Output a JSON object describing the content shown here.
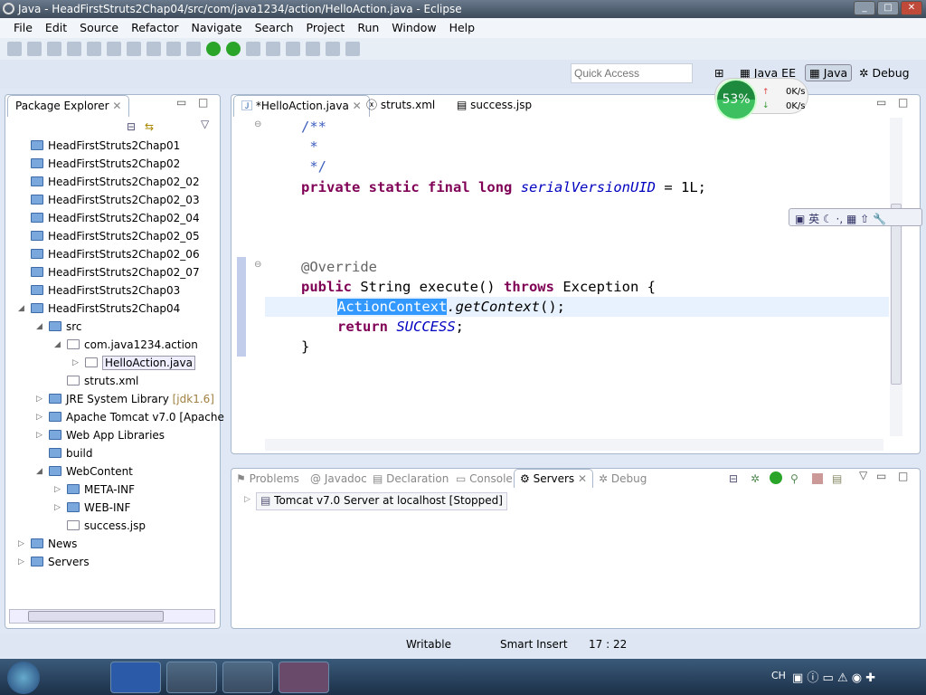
{
  "window": {
    "title": "Java - HeadFirstStruts2Chap04/src/com/java1234/action/HelloAction.java - Eclipse"
  },
  "menu": [
    "File",
    "Edit",
    "Source",
    "Refactor",
    "Navigate",
    "Search",
    "Project",
    "Run",
    "Window",
    "Help"
  ],
  "quick_access": {
    "placeholder": "Quick Access"
  },
  "perspectives": {
    "javaee": "Java EE",
    "java": "Java",
    "debug": "Debug"
  },
  "net_widget": {
    "percent": "53%",
    "up": "0K/s",
    "down": "0K/s"
  },
  "package_explorer": {
    "title": "Package Explorer",
    "items": [
      {
        "label": "HeadFirstStruts2Chap01",
        "level": 0
      },
      {
        "label": "HeadFirstStruts2Chap02",
        "level": 0
      },
      {
        "label": "HeadFirstStruts2Chap02_02",
        "level": 0
      },
      {
        "label": "HeadFirstStruts2Chap02_03",
        "level": 0
      },
      {
        "label": "HeadFirstStruts2Chap02_04",
        "level": 0
      },
      {
        "label": "HeadFirstStruts2Chap02_05",
        "level": 0
      },
      {
        "label": "HeadFirstStruts2Chap02_06",
        "level": 0
      },
      {
        "label": "HeadFirstStruts2Chap02_07",
        "level": 0
      },
      {
        "label": "HeadFirstStruts2Chap03",
        "level": 0
      },
      {
        "label": "HeadFirstStruts2Chap04",
        "level": 0,
        "arrow": "expanded"
      },
      {
        "label": "src",
        "level": 1,
        "arrow": "expanded"
      },
      {
        "label": "com.java1234.action",
        "level": 2,
        "arrow": "expanded"
      },
      {
        "label": "HelloAction.java",
        "level": 3,
        "arrow": "collapsed",
        "selected": true
      },
      {
        "label": "struts.xml",
        "level": 2
      },
      {
        "label": "JRE System Library",
        "extra": "[jdk1.6]",
        "level": 1,
        "arrow": "collapsed"
      },
      {
        "label": "Apache Tomcat v7.0 [Apache",
        "level": 1,
        "arrow": "collapsed"
      },
      {
        "label": "Web App Libraries",
        "level": 1,
        "arrow": "collapsed"
      },
      {
        "label": "build",
        "level": 1
      },
      {
        "label": "WebContent",
        "level": 1,
        "arrow": "expanded"
      },
      {
        "label": "META-INF",
        "level": 2,
        "arrow": "collapsed"
      },
      {
        "label": "WEB-INF",
        "level": 2,
        "arrow": "collapsed"
      },
      {
        "label": "success.jsp",
        "level": 2
      },
      {
        "label": "News",
        "level": 0,
        "arrow": "collapsed"
      },
      {
        "label": "Servers",
        "level": 0,
        "arrow": "collapsed"
      }
    ]
  },
  "editor": {
    "tabs": [
      "*HelloAction.java",
      "struts.xml",
      "success.jsp"
    ],
    "lines": {
      "c1": "/**",
      "c2": " *",
      "c3": " */",
      "private": "private",
      "static": "static",
      "final": "final",
      "long": "long",
      "field": "serialVersionUID",
      "assign": " = 1L;",
      "override": "@Override",
      "public": "public",
      "sig": " String execute() ",
      "throws": "throws",
      "exc": " Exception {",
      "cls": "ActionContext",
      "call": ".getContext",
      "callend": "();",
      "return": "return",
      "success": "SUCCESS",
      "semi": ";",
      "close": "}"
    }
  },
  "ime_bar": {
    "lang": "英"
  },
  "bottom_panel": {
    "tabs": [
      "Problems",
      "Javadoc",
      "Declaration",
      "Console",
      "Servers",
      "Debug"
    ],
    "active": "Servers",
    "server": "Tomcat v7.0 Server at localhost  [Stopped]"
  },
  "status": {
    "writable": "Writable",
    "insert": "Smart Insert",
    "position": "17 : 22"
  },
  "taskbar": {
    "lang": "CH"
  }
}
